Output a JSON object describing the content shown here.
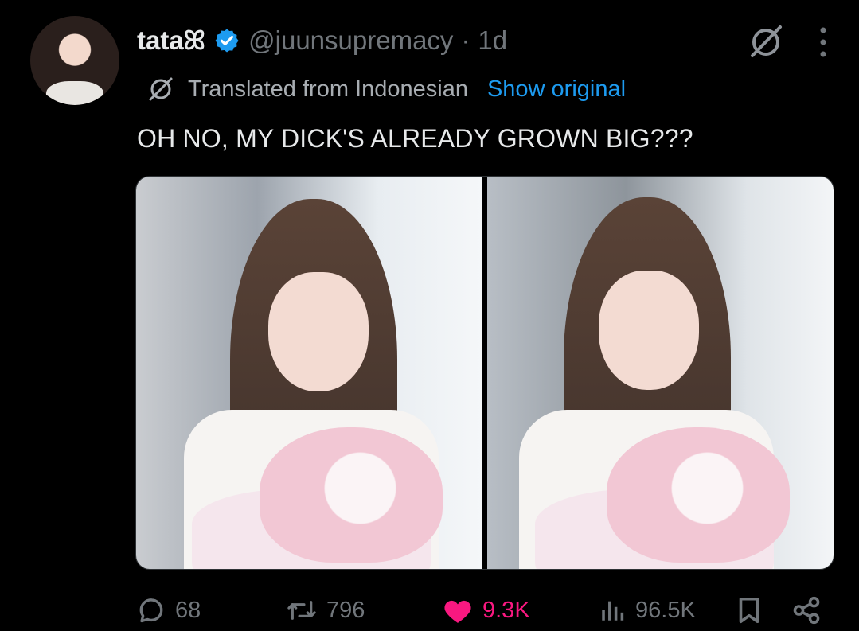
{
  "author": {
    "name": "tataꕤ",
    "handle": "@juunsupremacy",
    "separator": "·",
    "time": "1d"
  },
  "translation": {
    "label": "Translated from Indonesian",
    "link": "Show original",
    "icon": "globe-icon"
  },
  "tweet": {
    "text": "OH NO, MY DICK'S ALREADY GROWN BIG???"
  },
  "actions": {
    "reply_count": "68",
    "retweet_count": "796",
    "like_count": "9.3K",
    "view_count": "96.5K"
  },
  "colors": {
    "background": "#000000",
    "text_primary": "#e7e9ea",
    "text_secondary": "#71767b",
    "link": "#1d9bf0",
    "like": "#f91880",
    "verified": "#1d9bf0"
  },
  "icons": {
    "verified": "verified-badge-icon",
    "grok": "grok-icon",
    "more": "more-icon",
    "reply": "reply-icon",
    "retweet": "retweet-icon",
    "like": "heart-icon",
    "views": "views-icon",
    "bookmark": "bookmark-icon",
    "share": "share-icon"
  }
}
